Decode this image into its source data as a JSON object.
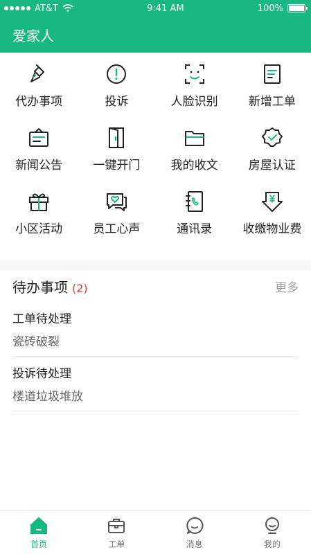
{
  "status_bar": {
    "carrier": "AT&T",
    "time": "9:41 AM",
    "battery": "100%"
  },
  "header": {
    "title": "爱家人"
  },
  "grid": [
    {
      "label": "代办事项",
      "icon": "broom-icon"
    },
    {
      "label": "投诉",
      "icon": "alert-icon"
    },
    {
      "label": "人脸识别",
      "icon": "face-scan-icon"
    },
    {
      "label": "新增工单",
      "icon": "new-order-icon"
    },
    {
      "label": "新闻公告",
      "icon": "news-icon"
    },
    {
      "label": "一键开门",
      "icon": "door-icon"
    },
    {
      "label": "我的收文",
      "icon": "folder-icon"
    },
    {
      "label": "房屋认证",
      "icon": "badge-icon"
    },
    {
      "label": "小区活动",
      "icon": "gift-icon"
    },
    {
      "label": "员工心声",
      "icon": "chat-heart-icon"
    },
    {
      "label": "通讯录",
      "icon": "contacts-icon"
    },
    {
      "label": "收缴物业费",
      "icon": "payment-icon"
    }
  ],
  "todo": {
    "title": "待办事项",
    "count": "(2)",
    "more": "更多",
    "items": [
      {
        "title": "工单待处理",
        "subtitle": "瓷砖破裂"
      },
      {
        "title": "投诉待处理",
        "subtitle": "楼道垃圾堆放"
      }
    ]
  },
  "tabbar": {
    "tabs": [
      {
        "label": "首页",
        "icon": "home-icon",
        "active": true
      },
      {
        "label": "工单",
        "icon": "briefcase-icon",
        "active": false
      },
      {
        "label": "消息",
        "icon": "message-icon",
        "active": false
      },
      {
        "label": "我的",
        "icon": "user-icon",
        "active": false
      }
    ]
  },
  "colors": {
    "brand": "#19b882",
    "alert": "#e23b3b"
  }
}
